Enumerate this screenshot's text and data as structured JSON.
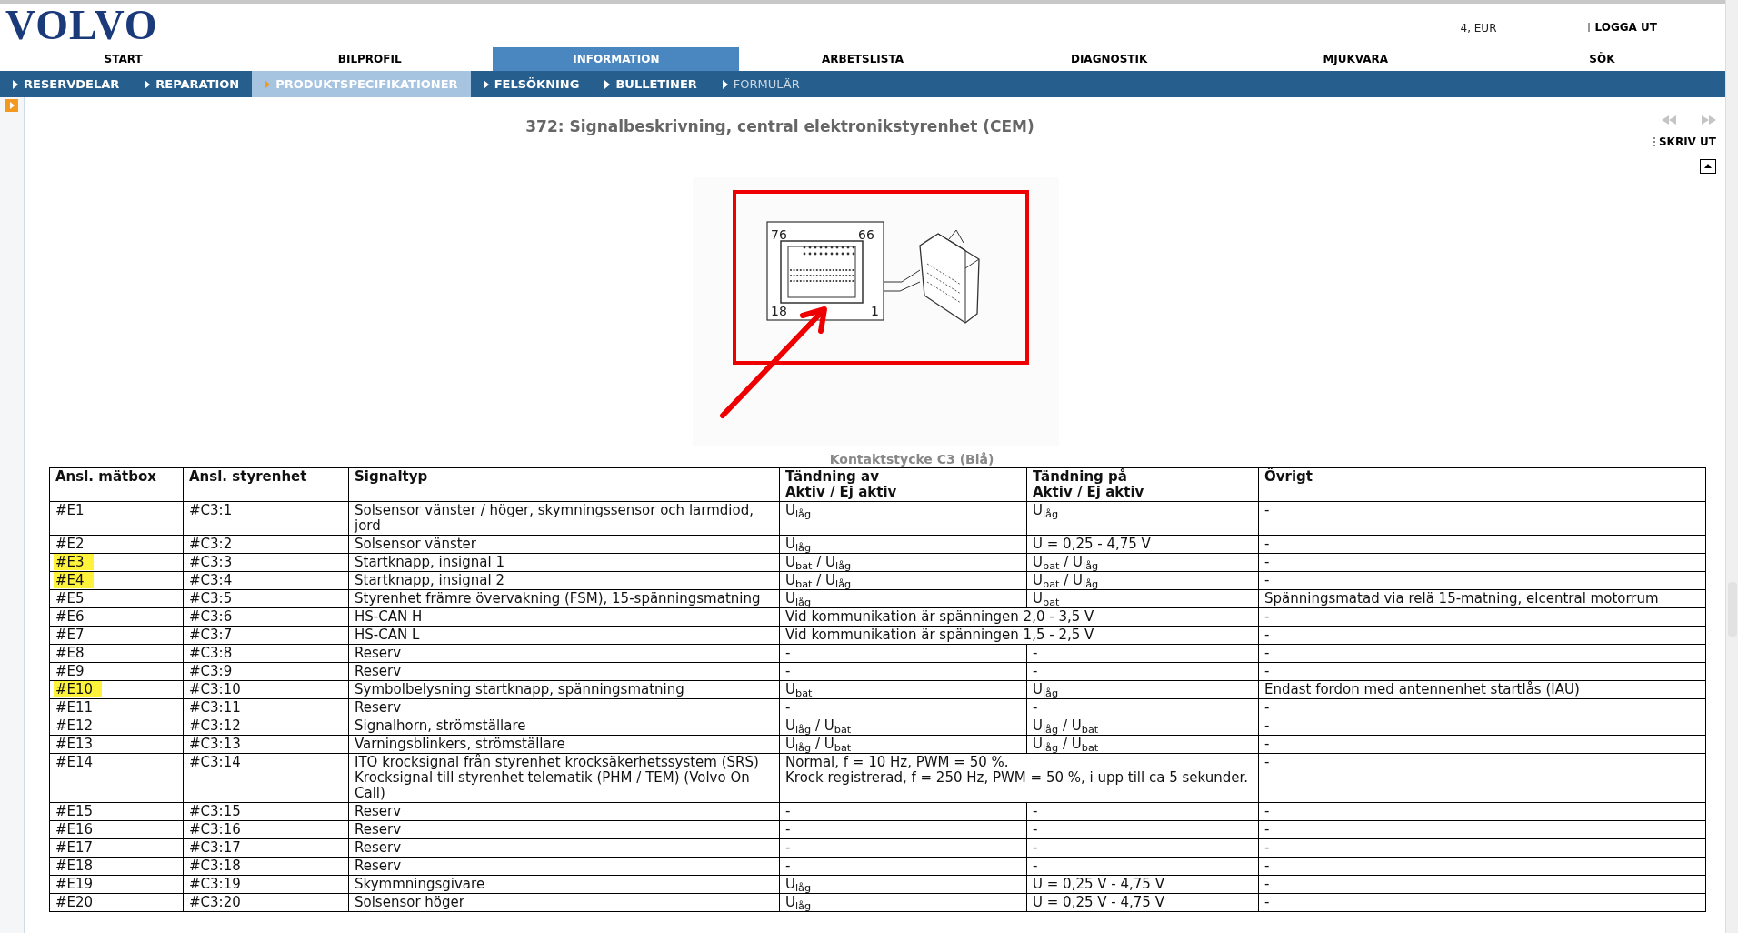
{
  "header": {
    "logo": "VOLVO",
    "account": "4, EUR",
    "logout": "LOGGA UT"
  },
  "main_nav": [
    {
      "label": "START",
      "selected": false
    },
    {
      "label": "BILPROFIL",
      "selected": false
    },
    {
      "label": "INFORMATION",
      "selected": true
    },
    {
      "label": "ARBETSLISTA",
      "selected": false
    },
    {
      "label": "DIAGNOSTIK",
      "selected": false
    },
    {
      "label": "MJUKVARA",
      "selected": false
    },
    {
      "label": "SÖK",
      "selected": false
    }
  ],
  "sub_nav": [
    {
      "label": "RESERVDELAR",
      "selected": false,
      "disabled": false
    },
    {
      "label": "REPARATION",
      "selected": false,
      "disabled": false
    },
    {
      "label": "PRODUKTSPECIFIKATIONER",
      "selected": true,
      "disabled": false
    },
    {
      "label": "FELSÖKNING",
      "selected": false,
      "disabled": false
    },
    {
      "label": "BULLETINER",
      "selected": false,
      "disabled": false
    },
    {
      "label": "FORMULÄR",
      "selected": false,
      "disabled": true
    }
  ],
  "title": "372: Signalbeskrivning, central elektronikstyrenhet (CEM)",
  "print": "SKRIV UT",
  "diagram": {
    "labels": [
      "76",
      "66",
      "18",
      "1"
    ]
  },
  "caption": "Kontaktstycke C3 (Blå)",
  "table": {
    "columns": [
      "Ansl. mätbox",
      "Ansl. styrenhet",
      "Signaltyp",
      "Tändning av\nAktiv / Ej aktiv",
      "Tändning på\nAktiv / Ej aktiv",
      "Övrigt"
    ],
    "rows": [
      {
        "highlighted": false,
        "cells": [
          "#E1",
          "#C3:1",
          "Solsensor vänster / höger, skymningssensor och larmdiod, jord",
          "U$_{låg}$",
          "U$_{låg}$",
          "-"
        ]
      },
      {
        "highlighted": false,
        "cells": [
          "#E2",
          "#C3:2",
          "Solsensor vänster",
          "U$_{låg}$",
          "U = 0,25 - 4,75 V",
          "-"
        ]
      },
      {
        "highlighted": true,
        "cells": [
          "#E3",
          "#C3:3",
          "Startknapp, insignal 1",
          "U$_{bat}$ / U$_{låg}$",
          "U$_{bat}$ / U$_{låg}$",
          "-"
        ]
      },
      {
        "highlighted": true,
        "cells": [
          "#E4",
          "#C3:4",
          "Startknapp, insignal 2",
          "U$_{bat}$ / U$_{låg}$",
          "U$_{bat}$ / U$_{låg}$",
          "-"
        ]
      },
      {
        "highlighted": false,
        "cells": [
          "#E5",
          "#C3:5",
          "Styrenhet främre övervakning (FSM), 15-spänningsmatning",
          "U$_{låg}$",
          "U$_{bat}$",
          "Spänningsmatad via relä 15-matning, elcentral motorrum"
        ]
      },
      {
        "highlighted": false,
        "cells": [
          "#E6",
          "#C3:6",
          "HS-CAN H",
          {
            "text": "Vid kommunikation är spänningen 2,0 - 3,5 V",
            "colspan": 2
          },
          "-"
        ]
      },
      {
        "highlighted": false,
        "cells": [
          "#E7",
          "#C3:7",
          "HS-CAN L",
          {
            "text": "Vid kommunikation är spänningen 1,5 - 2,5 V",
            "colspan": 2
          },
          "-"
        ]
      },
      {
        "highlighted": false,
        "cells": [
          "#E8",
          "#C3:8",
          "Reserv",
          "-",
          "-",
          "-"
        ]
      },
      {
        "highlighted": false,
        "cells": [
          "#E9",
          "#C3:9",
          "Reserv",
          "-",
          "-",
          "-"
        ]
      },
      {
        "highlighted": true,
        "cells": [
          "#E10",
          "#C3:10",
          "Symbolbelysning startknapp, spänningsmatning",
          "U$_{bat}$",
          "U$_{låg}$",
          "Endast fordon med antennenhet startlås (IAU)"
        ]
      },
      {
        "highlighted": false,
        "cells": [
          "#E11",
          "#C3:11",
          "Reserv",
          "-",
          "-",
          "-"
        ]
      },
      {
        "highlighted": false,
        "cells": [
          "#E12",
          "#C3:12",
          "Signalhorn, strömställare",
          "U$_{låg}$ / U$_{bat}$",
          "U$_{låg}$ / U$_{bat}$",
          "-"
        ]
      },
      {
        "highlighted": false,
        "cells": [
          "#E13",
          "#C3:13",
          "Varningsblinkers, strömställare",
          "U$_{låg}$ / U$_{bat}$",
          "U$_{låg}$ / U$_{bat}$",
          "-"
        ]
      },
      {
        "highlighted": false,
        "cells": [
          "#E14",
          "#C3:14",
          "ITO krocksignal från styrenhet krocksäkerhetssystem (SRS)\nKrocksignal till styrenhet telematik (PHM / TEM) (Volvo On Call)",
          {
            "text": "Normal, f = 10 Hz, PWM = 50 %.\nKrock registrerad, f = 250 Hz, PWM = 50 %, i upp till ca 5 sekunder.",
            "colspan": 2
          },
          "-"
        ]
      },
      {
        "highlighted": false,
        "cells": [
          "#E15",
          "#C3:15",
          "Reserv",
          "-",
          "-",
          "-"
        ]
      },
      {
        "highlighted": false,
        "cells": [
          "#E16",
          "#C3:16",
          "Reserv",
          "-",
          "-",
          "-"
        ]
      },
      {
        "highlighted": false,
        "cells": [
          "#E17",
          "#C3:17",
          "Reserv",
          "-",
          "-",
          "-"
        ]
      },
      {
        "highlighted": false,
        "cells": [
          "#E18",
          "#C3:18",
          "Reserv",
          "-",
          "-",
          "-"
        ]
      },
      {
        "highlighted": false,
        "cells": [
          "#E19",
          "#C3:19",
          "Skymmningsgivare",
          "U$_{låg}$",
          "U = 0,25 V - 4,75 V",
          "-"
        ]
      },
      {
        "highlighted": false,
        "cells": [
          "#E20",
          "#C3:20",
          "Solsensor höger",
          "U$_{låg}$",
          "U = 0,25 V - 4,75 V",
          "-"
        ]
      }
    ]
  }
}
